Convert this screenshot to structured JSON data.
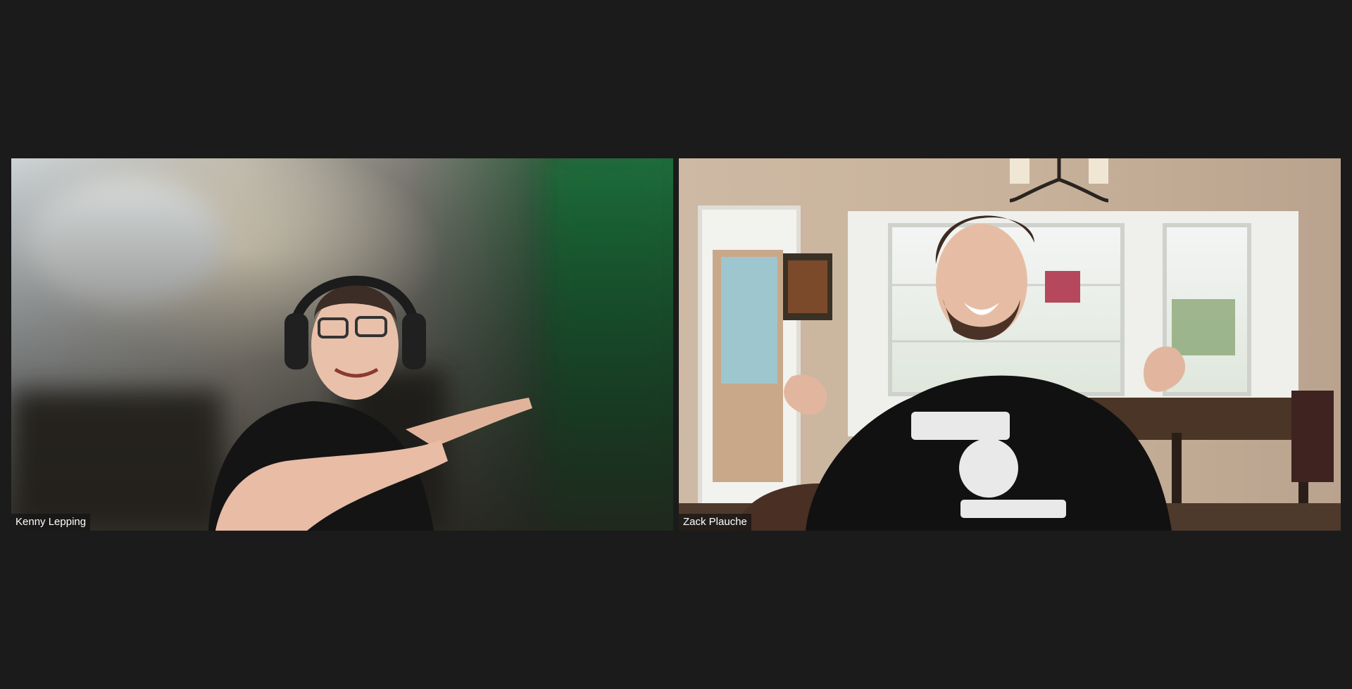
{
  "meeting": {
    "layout": "gallery",
    "background_color": "#1b1b1b"
  },
  "participants": [
    {
      "name": "Kenny Lepping",
      "video_icon": "video-feed",
      "scene": "man with headphones and glasses pointing, blurred background with green screen"
    },
    {
      "name": "Zack Plauche",
      "video_icon": "video-feed",
      "scene": "man in black hoodie with thumbs gesture in dining room with chandelier"
    }
  ]
}
